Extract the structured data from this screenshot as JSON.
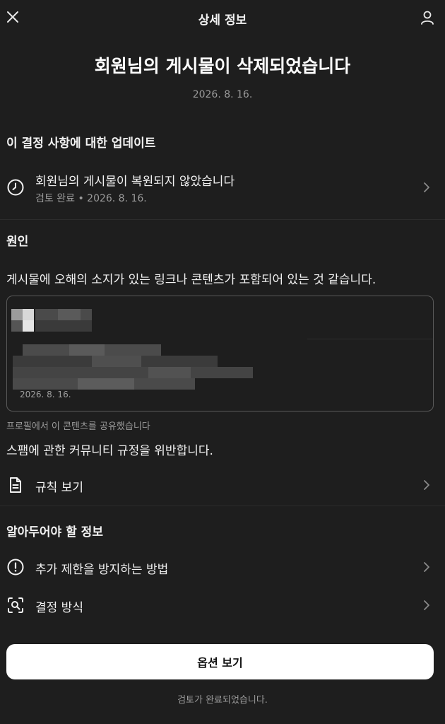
{
  "header": {
    "title": "상세 정보",
    "close_icon": "close-icon",
    "profile_icon": "person-icon"
  },
  "headline": "회원님의 게시물이 삭제되었습니다",
  "date": "2026. 8. 16.",
  "update_section": {
    "title": "이 결정 사항에 대한 업데이트",
    "item": {
      "label": "회원님의 게시물이 복원되지 않았습니다",
      "status": "검토 완료",
      "separator": "•",
      "date": "2026. 8. 16.",
      "icon": "clock-icon"
    }
  },
  "reason_section": {
    "title": "원인",
    "text": "게시물에 오해의 소지가 있는 링크나 콘텐츠가 포함되어 있는 것 같습니다.",
    "preview": {
      "date": "2026. 8. 16."
    },
    "shared_note": "프로필에서 이 콘텐츠를 공유했습니다",
    "violation": "스팸에 관한 커뮤니티 규정을 위반합니다.",
    "rules_label": "규칙 보기",
    "rules_icon": "document-icon"
  },
  "info_section": {
    "title": "알아두어야 할 정보",
    "items": [
      {
        "label": "추가 제한을 방지하는 방법",
        "icon": "alert-circle-icon"
      },
      {
        "label": "결정 방식",
        "icon": "search-scan-icon"
      }
    ]
  },
  "button_label": "옵션 보기",
  "footer_note": "검토가 완료되었습니다.",
  "colors": {
    "background": "#1e1e1e",
    "text": "#f2f2f2",
    "muted": "#9a9a9a",
    "button_bg": "#ffffff",
    "button_text": "#111111"
  }
}
